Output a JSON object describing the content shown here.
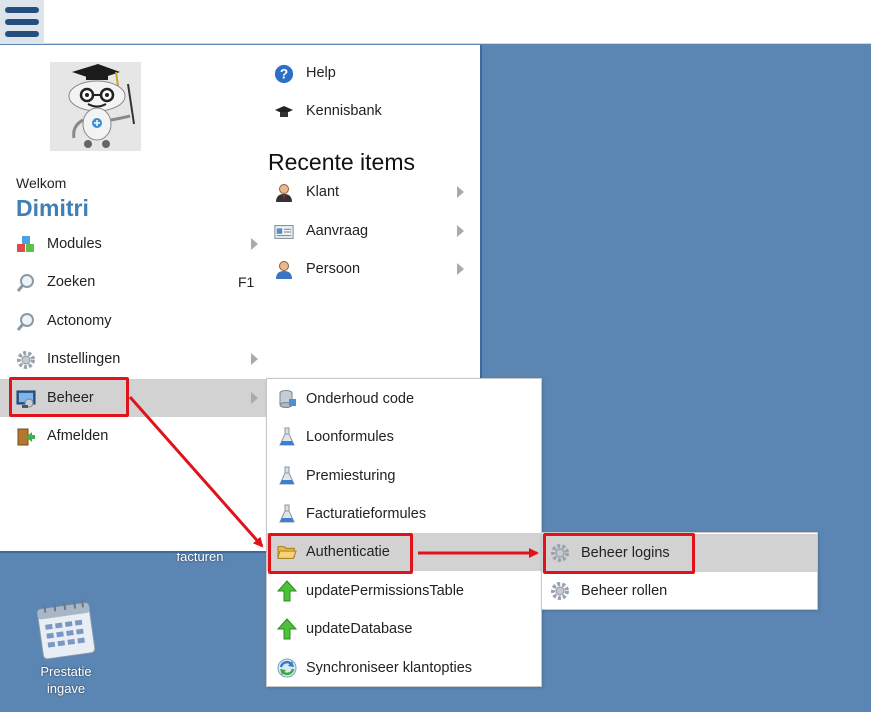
{
  "sidebar": {
    "welcome": "Welkom",
    "username": "Dimitri",
    "items": [
      {
        "label": "Modules",
        "icon": "modules-cubes-icon",
        "has_submenu": true,
        "shortcut": ""
      },
      {
        "label": "Zoeken",
        "icon": "search-magnifier-icon",
        "has_submenu": false,
        "shortcut": "F1"
      },
      {
        "label": "Actonomy",
        "icon": "search-magnifier-icon",
        "has_submenu": false,
        "shortcut": ""
      },
      {
        "label": "Instellingen",
        "icon": "gear-icon",
        "has_submenu": true,
        "shortcut": ""
      },
      {
        "label": "Beheer",
        "icon": "admin-monitor-icon",
        "has_submenu": true,
        "shortcut": "",
        "active": true
      },
      {
        "label": "Afmelden",
        "icon": "logout-door-icon",
        "has_submenu": false,
        "shortcut": ""
      }
    ]
  },
  "help": {
    "items": [
      {
        "label": "Help",
        "icon": "help-question-icon"
      },
      {
        "label": "Kennisbank",
        "icon": "graduation-cap-icon"
      }
    ]
  },
  "recent": {
    "title": "Recente items",
    "items": [
      {
        "label": "Klant",
        "icon": "customer-person-icon"
      },
      {
        "label": "Aanvraag",
        "icon": "request-form-icon"
      },
      {
        "label": "Persoon",
        "icon": "person-icon"
      }
    ]
  },
  "beheer_submenu": {
    "items": [
      {
        "label": "Onderhoud code",
        "icon": "database-icon"
      },
      {
        "label": "Loonformules",
        "icon": "flask-icon"
      },
      {
        "label": "Premiesturing",
        "icon": "flask-icon"
      },
      {
        "label": "Facturatieformules",
        "icon": "flask-icon"
      },
      {
        "label": "Authenticatie",
        "icon": "folder-open-icon",
        "active": true
      },
      {
        "label": "updatePermissionsTable",
        "icon": "green-up-arrow-icon"
      },
      {
        "label": "updateDatabase",
        "icon": "green-up-arrow-icon"
      },
      {
        "label": "Synchroniseer klantopties",
        "icon": "sync-icon"
      }
    ]
  },
  "auth_submenu": {
    "items": [
      {
        "label": "Beheer logins",
        "icon": "gear-icon",
        "active": true
      },
      {
        "label": "Beheer rollen",
        "icon": "gear-icon"
      }
    ]
  },
  "desktop": {
    "partial_label": "facturen",
    "prestatie_label_1": "Prestatie",
    "prestatie_label_2": "ingave"
  },
  "colors": {
    "desktop_bg": "#5b86b4",
    "accent_blue": "#3f7fb3",
    "highlight_gray": "#d2d2d2",
    "annotation_red": "#e0131b"
  }
}
